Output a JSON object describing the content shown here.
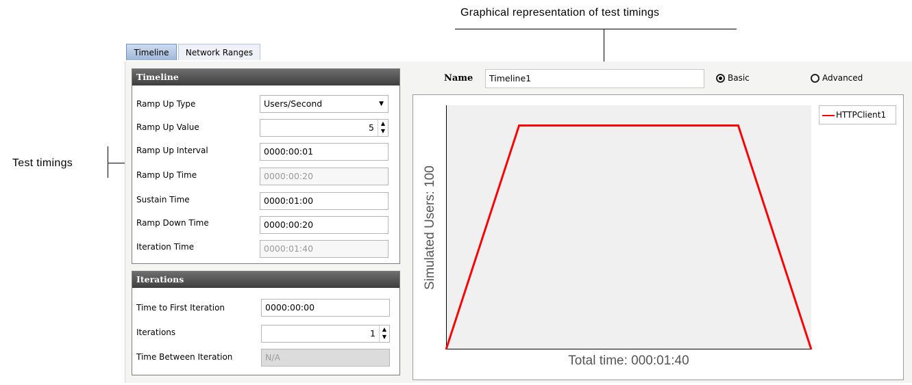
{
  "annotations": {
    "top": "Graphical representation of test timings",
    "left": "Test timings"
  },
  "tabs": [
    {
      "label": "Timeline",
      "active": true
    },
    {
      "label": "Network Ranges",
      "active": false
    }
  ],
  "timeline_group": {
    "title": "Timeline",
    "fields": [
      {
        "label": "Ramp Up Type",
        "value": "Users/Second"
      },
      {
        "label": "Ramp Up Value",
        "value": "5"
      },
      {
        "label": "Ramp Up Interval",
        "value": "0000:00:01"
      },
      {
        "label": "Ramp Up Time",
        "value": "0000:00:20"
      },
      {
        "label": "Sustain Time",
        "value": "0000:01:00"
      },
      {
        "label": "Ramp Down Time",
        "value": "0000:00:20"
      },
      {
        "label": "Iteration Time",
        "value": "0000:01:40"
      }
    ]
  },
  "iterations_group": {
    "title": "Iterations",
    "fields": [
      {
        "label": "Time to First Iteration",
        "value": "0000:00:00"
      },
      {
        "label": "Iterations",
        "value": "1"
      },
      {
        "label": "Time  Between Iteration",
        "value": "N/A"
      }
    ]
  },
  "name_bar": {
    "label": "Name",
    "value": "Timeline1",
    "basic_label": "Basic",
    "advanced_label": "Advanced",
    "selected_mode": "Basic"
  },
  "chart_data": {
    "type": "line",
    "ylabel": "Simulated Users: 100",
    "xlabel": "Total time: 000:01:40",
    "legend_position": "top-right",
    "series": [
      {
        "name": "HTTPClient1",
        "color": "#ff0000",
        "x": [
          0,
          20,
          80,
          100
        ],
        "y": [
          0,
          100,
          100,
          0
        ]
      }
    ],
    "xlim": [
      0,
      100
    ],
    "ylim": [
      0,
      109
    ]
  },
  "colors": {
    "series_line": "#ff0000",
    "group_header": "#4a4a4a",
    "tab_active": "#b0c4e4"
  }
}
